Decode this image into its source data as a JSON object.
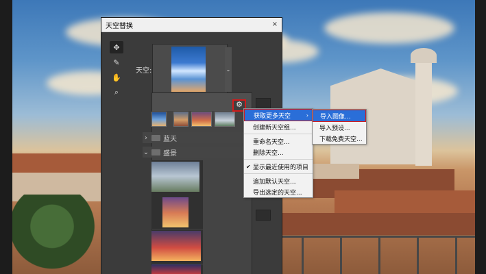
{
  "dialog": {
    "title": "天空替换",
    "close_label": "×",
    "sky_label": "天空:"
  },
  "tools": {
    "move_icon": "move-icon",
    "brush_icon": "brush-icon",
    "hand_icon": "hand-icon",
    "zoom_icon": "zoom-icon"
  },
  "preset_panel": {
    "gear_label": "⚙",
    "groups": [
      {
        "label": "蓝天",
        "chevron": "›"
      },
      {
        "label": "盛景",
        "chevron": "⌄"
      }
    ]
  },
  "context_menu": {
    "items": [
      "获取更多天空",
      "创建新天空组...",
      "重命名天空...",
      "删除天空...",
      "显示最近使用的项目",
      "追加默认天空...",
      "导出选定的天空..."
    ],
    "submenu_arrow": "›",
    "check_mark": "✔"
  },
  "submenu": {
    "items": [
      "导入图像...",
      "导入预设...",
      "下载免费天空..."
    ]
  }
}
